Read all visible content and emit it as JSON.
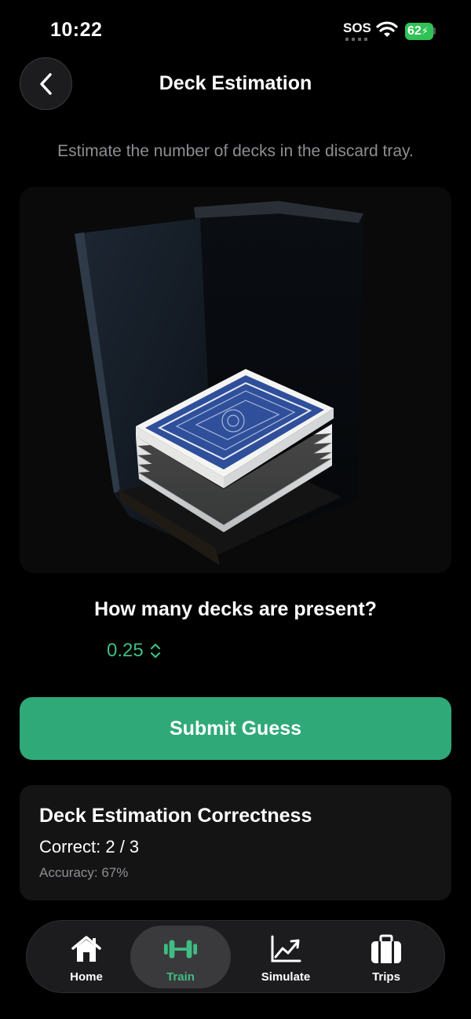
{
  "status_bar": {
    "time": "10:22",
    "sos": "SOS",
    "battery": "62"
  },
  "nav": {
    "title": "Deck Estimation"
  },
  "instruction": "Estimate the number of decks in the discard tray.",
  "question": "How many decks are present?",
  "stepper": {
    "value": "0.25"
  },
  "submit": {
    "label": "Submit Guess"
  },
  "stats": {
    "title": "Deck Estimation Correctness",
    "correct": "Correct: 2 / 3",
    "accuracy": "Accuracy: 67%"
  },
  "tabs": [
    {
      "label": "Home",
      "icon": "home-icon",
      "active": false
    },
    {
      "label": "Train",
      "icon": "dumbbell-icon",
      "active": true
    },
    {
      "label": "Simulate",
      "icon": "chart-line-icon",
      "active": false
    },
    {
      "label": "Trips",
      "icon": "briefcase-icon",
      "active": false
    }
  ],
  "colors": {
    "accent": "#2fa978",
    "accent_text": "#3ebd84",
    "background": "#000000",
    "card": "#141415"
  }
}
